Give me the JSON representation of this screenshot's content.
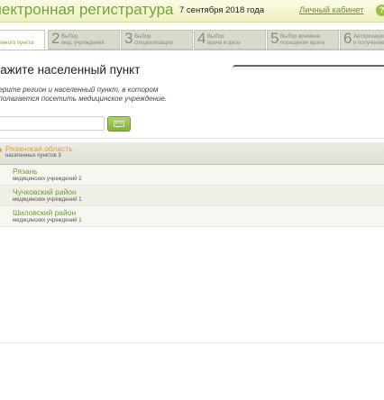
{
  "header": {
    "brand": "лектронная регистратура",
    "date": "7 сентября 2018 года",
    "cabinet_link": "Личный кабинет",
    "help": "?"
  },
  "steps": [
    {
      "num": "",
      "label": "р\nленного пункта",
      "active": true
    },
    {
      "num": "2",
      "label": "Выбор\nмед. учреждения"
    },
    {
      "num": "3",
      "label": "Выбор\nспециализации"
    },
    {
      "num": "4",
      "label": "Выбор\nврача и даты"
    },
    {
      "num": "5",
      "label": "Выбор времени\nпосещения врача"
    },
    {
      "num": "6",
      "label": "Авторизация\nи получение"
    }
  ],
  "main": {
    "title": "кажите населенный пункт",
    "description": "берите регион и населенный пункт, в котором\nдполагается посетить медицинское учреждение.",
    "search": {
      "value": "",
      "placeholder": ""
    }
  },
  "region": {
    "name": "Рязанская область",
    "count": "населенных пунктов 3"
  },
  "localities": [
    {
      "name": "Рязань",
      "sub": "медицинских учреждений 2"
    },
    {
      "name": "Чучковский район",
      "sub": "медицинских учреждений 1"
    },
    {
      "name": "Шиловский район",
      "sub": "медицинских учреждений 1"
    }
  ],
  "colors": {
    "brand": "#6fa63a",
    "region_accent": "#e0a030",
    "link_green": "#6aa032"
  }
}
